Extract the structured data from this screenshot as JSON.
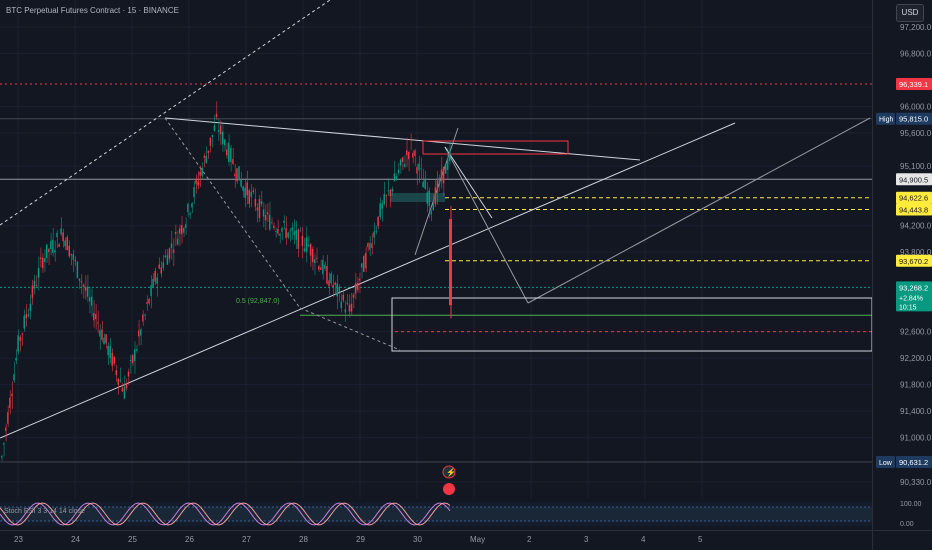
{
  "header": {
    "title": "BTC Perpetual Futures Contract · 15 · BINANCE",
    "currency": "USD"
  },
  "chart_data": {
    "type": "line",
    "y_axis": {
      "ticks": [
        "97,200.0",
        "96,800.0",
        "96,000.0",
        "95,600.0",
        "95,100.0",
        "94,200.0",
        "93,800.0",
        "92,600.0",
        "92,200.0",
        "91,800.0",
        "91,400.0",
        "91,000.0",
        "90,330.0"
      ],
      "tick_values": [
        97200,
        96800,
        96000,
        95600,
        95100,
        94200,
        93800,
        92600,
        92200,
        91800,
        91400,
        91000,
        90330
      ],
      "ylim": [
        90200,
        97400
      ]
    },
    "x_axis": {
      "ticks": [
        "23",
        "24",
        "25",
        "26",
        "27",
        "28",
        "29",
        "30",
        "May",
        "2",
        "3",
        "4",
        "5"
      ],
      "tick_positions_day": [
        0,
        1,
        2,
        3,
        4,
        5,
        6,
        7,
        8,
        9,
        10,
        11,
        12
      ]
    },
    "price_labels": [
      {
        "text": "96,339.1",
        "value": 96339.1,
        "color": "#f23645"
      },
      {
        "text": "95,815.0",
        "value": 95815.0,
        "color": "#1e3a5f",
        "tag": "High"
      },
      {
        "text": "94,900.5",
        "value": 94900.5,
        "color": "#e6e6e6",
        "text_color": "#131722"
      },
      {
        "text": "94,622.6",
        "value": 94622.6,
        "color": "#ffeb3b",
        "text_color": "#131722"
      },
      {
        "text": "94,443.8",
        "value": 94443.8,
        "color": "#ffeb3b",
        "text_color": "#131722"
      },
      {
        "text": "93,670.2",
        "value": 93670.2,
        "color": "#ffeb3b",
        "text_color": "#131722"
      },
      {
        "text": "93,268.2",
        "value": 93268.2,
        "color": "#089981",
        "sub1": "+2.84%",
        "sub2": "10:15"
      },
      {
        "text": "90,631.2",
        "value": 90631.2,
        "color": "#1e3a5f",
        "tag": "Low"
      }
    ],
    "fib_label": "0.5 (92,847.0)",
    "oscillator": {
      "label": "Stoch RSI 3 3 14 14 close",
      "ticks": [
        "100.00",
        "0.00"
      ]
    }
  }
}
